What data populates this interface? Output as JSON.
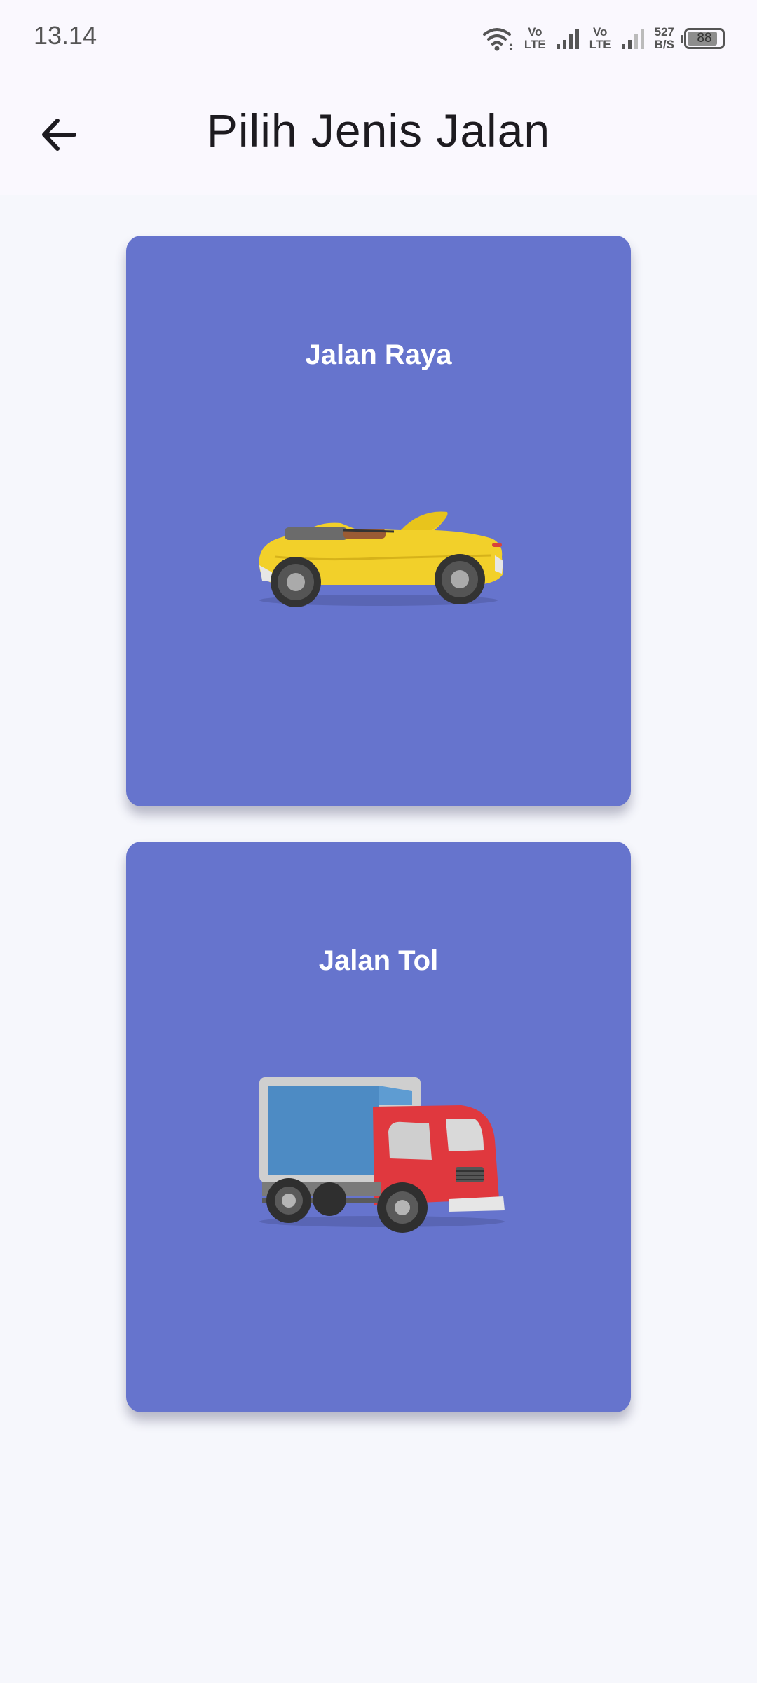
{
  "status_bar": {
    "time": "13.14",
    "vo_label": "Vo",
    "lte_label": "LTE",
    "speed_value": "527",
    "speed_unit": "B/S",
    "battery": "88"
  },
  "app_bar": {
    "title": "Pilih Jenis Jalan",
    "back_icon": "arrow-left-icon"
  },
  "options": [
    {
      "label": "Jalan Raya",
      "image": "convertible-car"
    },
    {
      "label": "Jalan Tol",
      "image": "delivery-truck"
    }
  ],
  "colors": {
    "card": "#6674cd",
    "background": "#f6f7fc",
    "app_bar": "#faf8fe"
  }
}
